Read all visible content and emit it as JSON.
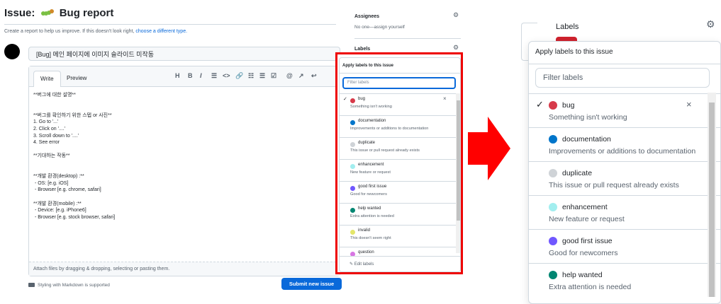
{
  "issue": {
    "title_prefix": "Issue:",
    "title": "Bug report",
    "subtitle": "Create a report to help us improve. If this doesn't look right,",
    "subtitle_link": "choose a different type.",
    "title_value": "[Bug] 메인 페이지에 이미지 슬라이드 미작동",
    "tabs": [
      "Write",
      "Preview"
    ],
    "toolbar": [
      "H",
      "B",
      "I",
      "☰",
      "<>",
      "🔗",
      "☷",
      "☰",
      "☑",
      "@",
      "↗",
      "↩"
    ],
    "body_text": "**버그에 대한 설명**\n\n\n**버그를 확인하기 위한 스텝 or 사진**\n1. Go to '...'\n2. Click on '....'\n3. Scroll down to '....'\n4. See error\n\n**기대하는 작동**\n\n\n**개발 환경(desktop) :**\n - OS: [e.g. iOS]\n - Browser [e.g. chrome, safari]\n\n**개발 환경(mobile) :**\n - Device: [e.g. iPhone6]\n - Browser [e.g. stock browser, safari]",
    "attach_text": "Attach files by dragging & dropping, selecting or pasting them.",
    "markdown_note": "Styling with Markdown is supported",
    "submit_label": "Submit new issue"
  },
  "sidebar": {
    "assignees_heading": "Assignees",
    "assignees_value": "No one—assign yourself",
    "labels_heading": "Labels"
  },
  "label_popup": {
    "heading": "Apply labels to this issue",
    "filter_placeholder": "Filter labels",
    "edit_labels": "Edit labels",
    "labels": [
      {
        "name": "bug",
        "description": "Something isn't working",
        "color": "#d73a4a",
        "selected": true
      },
      {
        "name": "documentation",
        "description": "Improvements or additions to documentation",
        "color": "#0075ca",
        "selected": false
      },
      {
        "name": "duplicate",
        "description": "This issue or pull request already exists",
        "color": "#cfd3d7",
        "selected": false
      },
      {
        "name": "enhancement",
        "description": "New feature or request",
        "color": "#a2eeef",
        "selected": false
      },
      {
        "name": "good first issue",
        "description": "Good for newcomers",
        "color": "#7057ff",
        "selected": false
      },
      {
        "name": "help wanted",
        "description": "Extra attention is needed",
        "color": "#008672",
        "selected": false
      },
      {
        "name": "invalid",
        "description": "This doesn't seem right",
        "color": "#e4e669",
        "selected": false
      },
      {
        "name": "question",
        "description": "",
        "color": "#d876e3",
        "selected": false
      }
    ]
  },
  "zoom": {
    "labels_heading": "Labels",
    "heading": "Apply labels to this issue",
    "filter_placeholder": "Filter labels",
    "visible_count": 6
  },
  "colors": {
    "highlight_border": "#e00000",
    "arrow": "#ff0000",
    "primary_button": "#0969da"
  }
}
